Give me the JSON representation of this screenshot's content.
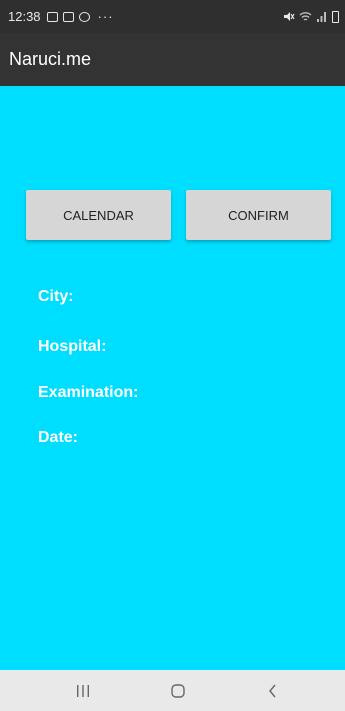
{
  "status_bar": {
    "time": "12:38",
    "dots": "···"
  },
  "app_bar": {
    "title": "Naruci.me"
  },
  "buttons": {
    "calendar_label": "CALENDAR",
    "confirm_label": "CONFIRM"
  },
  "info": {
    "city_label": "City:",
    "hospital_label": "Hospital:",
    "examination_label": "Examination:",
    "date_label": "Date:"
  },
  "colors": {
    "content_background": "#00deff",
    "app_bar": "#333333",
    "status_bar": "#2f2f2f",
    "button": "#d6d6d6"
  },
  "icons": {
    "status_left": [
      "gallery-icon",
      "notification-icon",
      "app-icon"
    ],
    "status_right": [
      "mute-icon",
      "wifi-icon",
      "signal-icon",
      "battery-icon"
    ],
    "nav": [
      "recents-icon",
      "home-icon",
      "back-icon"
    ]
  }
}
